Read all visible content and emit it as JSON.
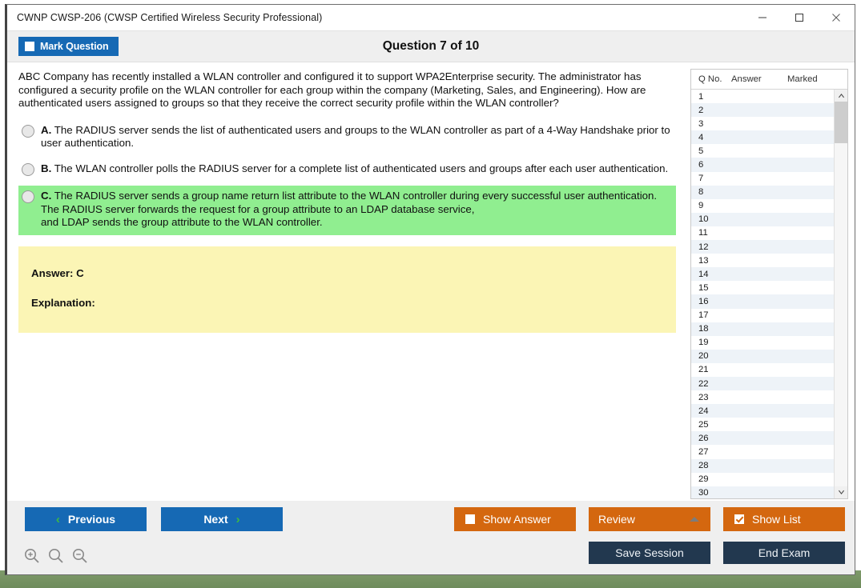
{
  "window": {
    "title": "CWNP CWSP-206 (CWSP Certified Wireless Security Professional)",
    "minimize_label": "—",
    "maximize_label": "□",
    "close_label": "✕"
  },
  "header": {
    "mark_button_label": "Mark Question",
    "question_title": "Question 7 of 10"
  },
  "question": {
    "text": "ABC Company has recently installed a WLAN controller and configured it to support WPA2Enterprise security. The administrator has configured a security profile on the WLAN controller for each group within the company (Marketing, Sales, and Engineering). How are authenticated users assigned to groups so that they receive the correct security profile within the WLAN controller?",
    "options": [
      {
        "letter": "A.",
        "text": "The RADIUS server sends the list of authenticated users and groups to the WLAN controller as part of a 4-Way Handshake prior to user authentication.",
        "correct": false
      },
      {
        "letter": "B.",
        "text": "The WLAN controller polls the RADIUS server for a complete list of authenticated users and groups after each user authentication.",
        "correct": false
      },
      {
        "letter": "C.",
        "text": "The RADIUS server sends a group name return list attribute to the WLAN controller during every successful user authentication.\nThe RADIUS server forwards the request for a group attribute to an LDAP database service,\nand LDAP sends the group attribute to the WLAN controller.",
        "correct": true
      }
    ]
  },
  "answer_panel": {
    "answer_label": "Answer: C",
    "explanation_label": "Explanation:"
  },
  "question_list": {
    "columns": [
      "Q No.",
      "Answer",
      "Marked"
    ],
    "rows": [
      {
        "no": "1",
        "answer": "",
        "marked": ""
      },
      {
        "no": "2",
        "answer": "",
        "marked": ""
      },
      {
        "no": "3",
        "answer": "",
        "marked": ""
      },
      {
        "no": "4",
        "answer": "",
        "marked": ""
      },
      {
        "no": "5",
        "answer": "",
        "marked": ""
      },
      {
        "no": "6",
        "answer": "",
        "marked": ""
      },
      {
        "no": "7",
        "answer": "",
        "marked": ""
      },
      {
        "no": "8",
        "answer": "",
        "marked": ""
      },
      {
        "no": "9",
        "answer": "",
        "marked": ""
      },
      {
        "no": "10",
        "answer": "",
        "marked": ""
      },
      {
        "no": "11",
        "answer": "",
        "marked": ""
      },
      {
        "no": "12",
        "answer": "",
        "marked": ""
      },
      {
        "no": "13",
        "answer": "",
        "marked": ""
      },
      {
        "no": "14",
        "answer": "",
        "marked": ""
      },
      {
        "no": "15",
        "answer": "",
        "marked": ""
      },
      {
        "no": "16",
        "answer": "",
        "marked": ""
      },
      {
        "no": "17",
        "answer": "",
        "marked": ""
      },
      {
        "no": "18",
        "answer": "",
        "marked": ""
      },
      {
        "no": "19",
        "answer": "",
        "marked": ""
      },
      {
        "no": "20",
        "answer": "",
        "marked": ""
      },
      {
        "no": "21",
        "answer": "",
        "marked": ""
      },
      {
        "no": "22",
        "answer": "",
        "marked": ""
      },
      {
        "no": "23",
        "answer": "",
        "marked": ""
      },
      {
        "no": "24",
        "answer": "",
        "marked": ""
      },
      {
        "no": "25",
        "answer": "",
        "marked": ""
      },
      {
        "no": "26",
        "answer": "",
        "marked": ""
      },
      {
        "no": "27",
        "answer": "",
        "marked": ""
      },
      {
        "no": "28",
        "answer": "",
        "marked": ""
      },
      {
        "no": "29",
        "answer": "",
        "marked": ""
      },
      {
        "no": "30",
        "answer": "",
        "marked": ""
      }
    ]
  },
  "footer": {
    "previous_label": "Previous",
    "next_label": "Next",
    "prev_chevron": "‹",
    "next_chevron": "›",
    "show_answer_label": "Show Answer",
    "review_label": "Review",
    "show_list_label": "Show List",
    "save_session_label": "Save Session",
    "end_exam_label": "End Exam"
  },
  "colors": {
    "blue_button": "#1669b4",
    "orange_button": "#d4670f",
    "navy_button": "#22384f",
    "correct_highlight": "#90ee90",
    "answer_panel": "#fbf5b5",
    "chevron_green": "#3fbb3f"
  }
}
